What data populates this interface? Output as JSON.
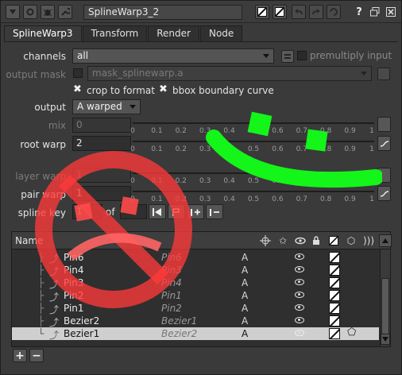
{
  "titlebar": {
    "node_name": "SplineWarp3_2",
    "help_label": "?"
  },
  "tabs": [
    {
      "label": "SplineWarp3",
      "active": true
    },
    {
      "label": "Transform",
      "active": false
    },
    {
      "label": "Render",
      "active": false
    },
    {
      "label": "Node",
      "active": false
    }
  ],
  "form": {
    "channels_label": "channels",
    "channels_value": "all",
    "premultiply_label": "premultiply input",
    "output_mask_label": "output mask",
    "output_mask_value": "mask_splinewarp.a",
    "crop_label": "crop to format",
    "bbox_label": "bbox boundary curve",
    "output_label": "output",
    "output_value": "A warped",
    "mix_label": "mix",
    "mix_value": "0",
    "root_warp_label": "root warp",
    "root_warp_value": "2",
    "layer_warp_label": "layer warp",
    "layer_warp_value": "1",
    "pair_warp_label": "pair warp",
    "pair_warp_value": "1",
    "spline_key_label": "spline key",
    "spline_key_value": "1",
    "spline_key_of": "of",
    "spline_key_total": ""
  },
  "slider_ticks": [
    "0",
    "0.1",
    "0.2",
    "0.3",
    "0.4",
    "0.5",
    "0.6",
    "0.7",
    "0.8",
    "0.9",
    "1"
  ],
  "table": {
    "name_header": "Name",
    "rows": [
      {
        "name": "Pin6",
        "parent": "Pin6",
        "a": "A"
      },
      {
        "name": "Pin4",
        "parent": "Pin3",
        "a": "A"
      },
      {
        "name": "Pin3",
        "parent": "Pin4",
        "a": "A"
      },
      {
        "name": "Pin2",
        "parent": "Pin1",
        "a": "A"
      },
      {
        "name": "Pin1",
        "parent": "Pin2",
        "a": "A"
      },
      {
        "name": "Bezier2",
        "parent": "Bezier1",
        "a": "A"
      },
      {
        "name": "Bezier1",
        "parent": "Bezier2",
        "a": "A"
      }
    ]
  },
  "footer": {
    "add_label": "+",
    "remove_label": "−"
  },
  "colors": {
    "smiley": "#14f51a",
    "sad": "#ff3a3a"
  }
}
